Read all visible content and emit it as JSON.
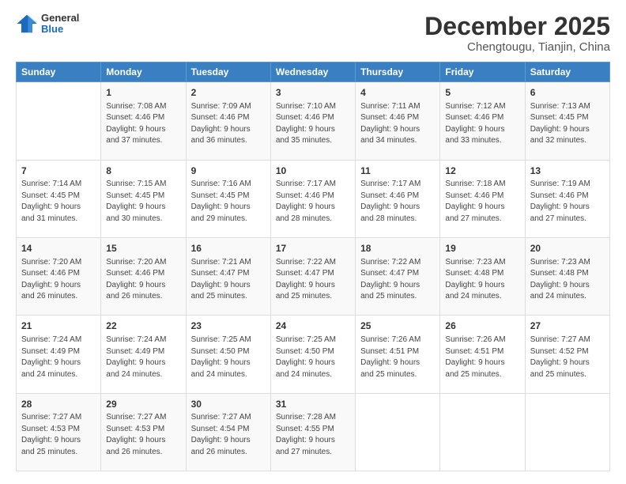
{
  "header": {
    "logo": {
      "general": "General",
      "blue": "Blue"
    },
    "title": "December 2025",
    "location": "Chengtougu, Tianjin, China"
  },
  "days_of_week": [
    "Sunday",
    "Monday",
    "Tuesday",
    "Wednesday",
    "Thursday",
    "Friday",
    "Saturday"
  ],
  "weeks": [
    [
      {
        "day": "",
        "sunrise": "",
        "sunset": "",
        "daylight": ""
      },
      {
        "day": "1",
        "sunrise": "Sunrise: 7:08 AM",
        "sunset": "Sunset: 4:46 PM",
        "daylight": "Daylight: 9 hours and 37 minutes."
      },
      {
        "day": "2",
        "sunrise": "Sunrise: 7:09 AM",
        "sunset": "Sunset: 4:46 PM",
        "daylight": "Daylight: 9 hours and 36 minutes."
      },
      {
        "day": "3",
        "sunrise": "Sunrise: 7:10 AM",
        "sunset": "Sunset: 4:46 PM",
        "daylight": "Daylight: 9 hours and 35 minutes."
      },
      {
        "day": "4",
        "sunrise": "Sunrise: 7:11 AM",
        "sunset": "Sunset: 4:46 PM",
        "daylight": "Daylight: 9 hours and 34 minutes."
      },
      {
        "day": "5",
        "sunrise": "Sunrise: 7:12 AM",
        "sunset": "Sunset: 4:46 PM",
        "daylight": "Daylight: 9 hours and 33 minutes."
      },
      {
        "day": "6",
        "sunrise": "Sunrise: 7:13 AM",
        "sunset": "Sunset: 4:45 PM",
        "daylight": "Daylight: 9 hours and 32 minutes."
      }
    ],
    [
      {
        "day": "7",
        "sunrise": "Sunrise: 7:14 AM",
        "sunset": "Sunset: 4:45 PM",
        "daylight": "Daylight: 9 hours and 31 minutes."
      },
      {
        "day": "8",
        "sunrise": "Sunrise: 7:15 AM",
        "sunset": "Sunset: 4:45 PM",
        "daylight": "Daylight: 9 hours and 30 minutes."
      },
      {
        "day": "9",
        "sunrise": "Sunrise: 7:16 AM",
        "sunset": "Sunset: 4:45 PM",
        "daylight": "Daylight: 9 hours and 29 minutes."
      },
      {
        "day": "10",
        "sunrise": "Sunrise: 7:17 AM",
        "sunset": "Sunset: 4:46 PM",
        "daylight": "Daylight: 9 hours and 28 minutes."
      },
      {
        "day": "11",
        "sunrise": "Sunrise: 7:17 AM",
        "sunset": "Sunset: 4:46 PM",
        "daylight": "Daylight: 9 hours and 28 minutes."
      },
      {
        "day": "12",
        "sunrise": "Sunrise: 7:18 AM",
        "sunset": "Sunset: 4:46 PM",
        "daylight": "Daylight: 9 hours and 27 minutes."
      },
      {
        "day": "13",
        "sunrise": "Sunrise: 7:19 AM",
        "sunset": "Sunset: 4:46 PM",
        "daylight": "Daylight: 9 hours and 27 minutes."
      }
    ],
    [
      {
        "day": "14",
        "sunrise": "Sunrise: 7:20 AM",
        "sunset": "Sunset: 4:46 PM",
        "daylight": "Daylight: 9 hours and 26 minutes."
      },
      {
        "day": "15",
        "sunrise": "Sunrise: 7:20 AM",
        "sunset": "Sunset: 4:46 PM",
        "daylight": "Daylight: 9 hours and 26 minutes."
      },
      {
        "day": "16",
        "sunrise": "Sunrise: 7:21 AM",
        "sunset": "Sunset: 4:47 PM",
        "daylight": "Daylight: 9 hours and 25 minutes."
      },
      {
        "day": "17",
        "sunrise": "Sunrise: 7:22 AM",
        "sunset": "Sunset: 4:47 PM",
        "daylight": "Daylight: 9 hours and 25 minutes."
      },
      {
        "day": "18",
        "sunrise": "Sunrise: 7:22 AM",
        "sunset": "Sunset: 4:47 PM",
        "daylight": "Daylight: 9 hours and 25 minutes."
      },
      {
        "day": "19",
        "sunrise": "Sunrise: 7:23 AM",
        "sunset": "Sunset: 4:48 PM",
        "daylight": "Daylight: 9 hours and 24 minutes."
      },
      {
        "day": "20",
        "sunrise": "Sunrise: 7:23 AM",
        "sunset": "Sunset: 4:48 PM",
        "daylight": "Daylight: 9 hours and 24 minutes."
      }
    ],
    [
      {
        "day": "21",
        "sunrise": "Sunrise: 7:24 AM",
        "sunset": "Sunset: 4:49 PM",
        "daylight": "Daylight: 9 hours and 24 minutes."
      },
      {
        "day": "22",
        "sunrise": "Sunrise: 7:24 AM",
        "sunset": "Sunset: 4:49 PM",
        "daylight": "Daylight: 9 hours and 24 minutes."
      },
      {
        "day": "23",
        "sunrise": "Sunrise: 7:25 AM",
        "sunset": "Sunset: 4:50 PM",
        "daylight": "Daylight: 9 hours and 24 minutes."
      },
      {
        "day": "24",
        "sunrise": "Sunrise: 7:25 AM",
        "sunset": "Sunset: 4:50 PM",
        "daylight": "Daylight: 9 hours and 24 minutes."
      },
      {
        "day": "25",
        "sunrise": "Sunrise: 7:26 AM",
        "sunset": "Sunset: 4:51 PM",
        "daylight": "Daylight: 9 hours and 25 minutes."
      },
      {
        "day": "26",
        "sunrise": "Sunrise: 7:26 AM",
        "sunset": "Sunset: 4:51 PM",
        "daylight": "Daylight: 9 hours and 25 minutes."
      },
      {
        "day": "27",
        "sunrise": "Sunrise: 7:27 AM",
        "sunset": "Sunset: 4:52 PM",
        "daylight": "Daylight: 9 hours and 25 minutes."
      }
    ],
    [
      {
        "day": "28",
        "sunrise": "Sunrise: 7:27 AM",
        "sunset": "Sunset: 4:53 PM",
        "daylight": "Daylight: 9 hours and 25 minutes."
      },
      {
        "day": "29",
        "sunrise": "Sunrise: 7:27 AM",
        "sunset": "Sunset: 4:53 PM",
        "daylight": "Daylight: 9 hours and 26 minutes."
      },
      {
        "day": "30",
        "sunrise": "Sunrise: 7:27 AM",
        "sunset": "Sunset: 4:54 PM",
        "daylight": "Daylight: 9 hours and 26 minutes."
      },
      {
        "day": "31",
        "sunrise": "Sunrise: 7:28 AM",
        "sunset": "Sunset: 4:55 PM",
        "daylight": "Daylight: 9 hours and 27 minutes."
      },
      {
        "day": "",
        "sunrise": "",
        "sunset": "",
        "daylight": ""
      },
      {
        "day": "",
        "sunrise": "",
        "sunset": "",
        "daylight": ""
      },
      {
        "day": "",
        "sunrise": "",
        "sunset": "",
        "daylight": ""
      }
    ]
  ]
}
